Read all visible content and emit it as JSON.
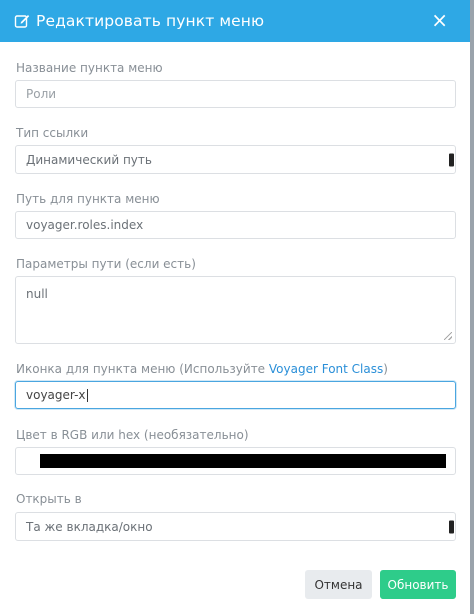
{
  "modal": {
    "title": "Редактировать пункт меню",
    "close_symbol": "×"
  },
  "form": {
    "name_label": "Название пункта меню",
    "name_placeholder": "Роли",
    "link_type_label": "Тип ссылки",
    "link_type_value": "Динамический путь",
    "route_label": "Путь для пункта меню",
    "route_value": "voyager.roles.index",
    "params_label": "Параметры пути (если есть)",
    "params_value": "null",
    "icon_label_prefix": "Иконка для пункта меню (Используйте ",
    "icon_label_link": "Voyager Font Class",
    "icon_label_suffix": ")",
    "icon_value": "voyager-x",
    "color_label": "Цвет в RGB или hex (необязательно)",
    "color_value": "#000000",
    "target_label": "Открыть в",
    "target_value": "Та же вкладка/окно"
  },
  "buttons": {
    "cancel": "Отмена",
    "save": "Обновить"
  },
  "colors": {
    "header": "#2ea8e5",
    "save_button": "#2ecc8a",
    "link": "#2a8fd8"
  }
}
